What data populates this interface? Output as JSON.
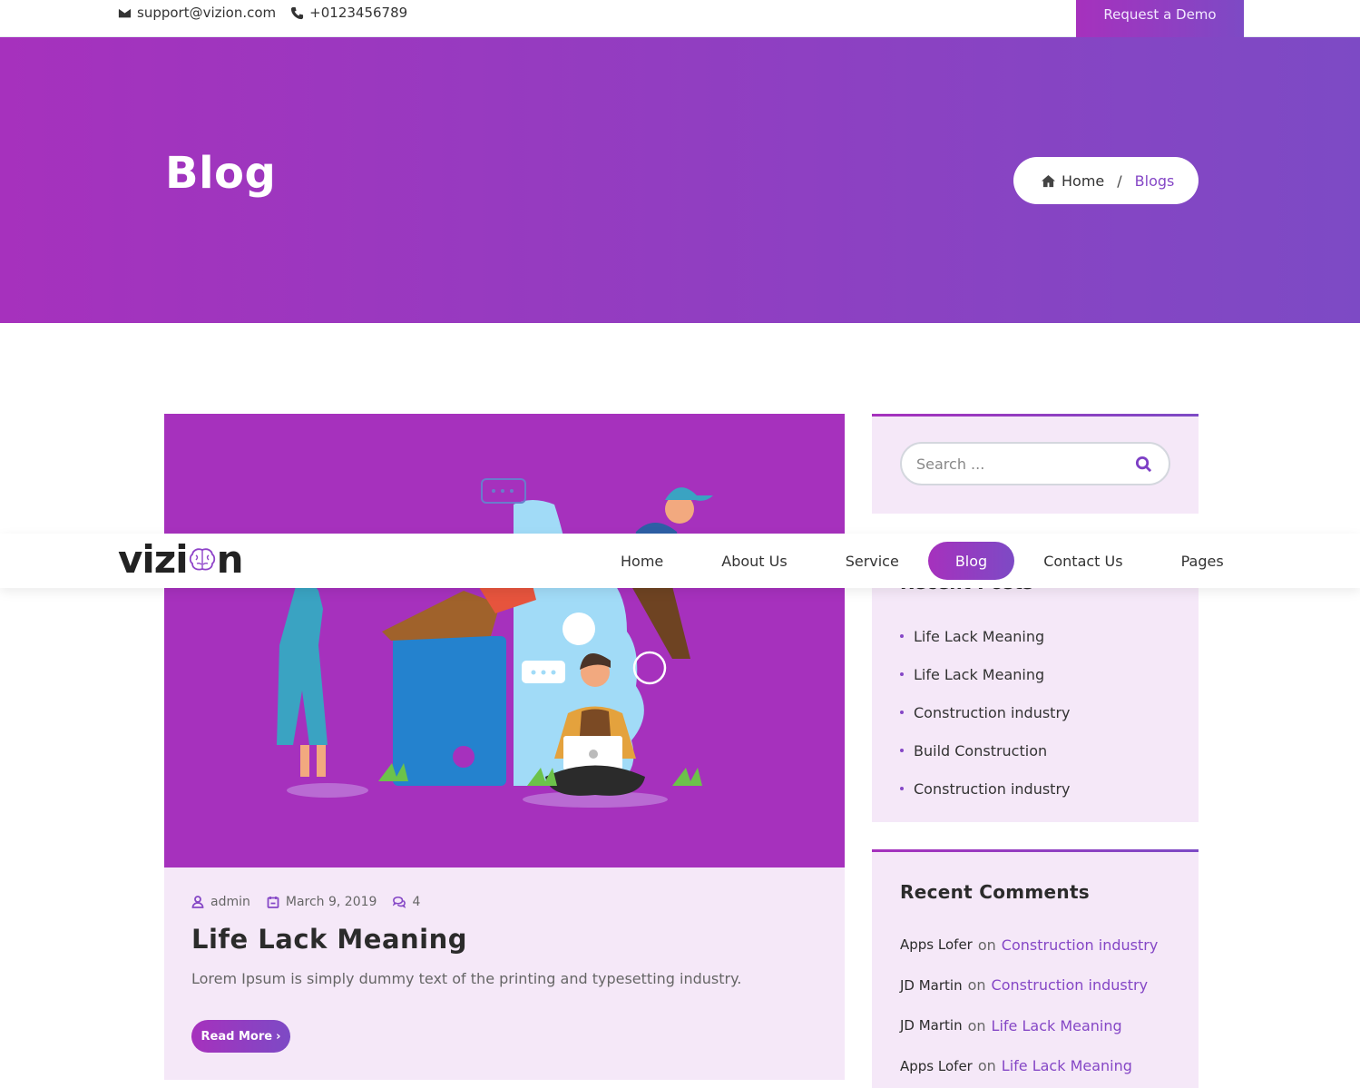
{
  "topbar": {
    "email": "support@vizion.com",
    "phone": "+0123456789",
    "demo_button": "Request a Demo"
  },
  "hero": {
    "title": "Blog",
    "breadcrumb": {
      "home": "Home",
      "separator": "/",
      "current": "Blogs"
    }
  },
  "navbar": {
    "logo_prefix": "vizi",
    "logo_suffix": "n",
    "items": [
      {
        "label": "Home",
        "active": false
      },
      {
        "label": "About Us",
        "active": false
      },
      {
        "label": "Service",
        "active": false
      },
      {
        "label": "Blog",
        "active": true
      },
      {
        "label": "Contact Us",
        "active": false
      },
      {
        "label": "Pages",
        "active": false
      }
    ]
  },
  "post": {
    "author": "admin",
    "date": "March 9, 2019",
    "comments": "4",
    "title": "Life Lack Meaning",
    "excerpt": "Lorem Ipsum is simply dummy text of the printing and typesetting industry.",
    "read_more": "Read More"
  },
  "sidebar": {
    "search_placeholder": "Search ...",
    "recent_posts_title": "Recent Posts",
    "recent_posts": [
      "Life Lack Meaning",
      "Life Lack Meaning",
      "Construction industry",
      "Build Construction",
      "Construction industry"
    ],
    "recent_comments_title": "Recent Comments",
    "recent_comments": [
      {
        "author": "Apps Lofer",
        "on": "on",
        "post": "Construction industry"
      },
      {
        "author": "JD Martin",
        "on": "on",
        "post": "Construction industry"
      },
      {
        "author": "JD Martin",
        "on": "on",
        "post": "Life Lack Meaning"
      },
      {
        "author": "Apps Lofer",
        "on": "on",
        "post": "Life Lack Meaning"
      }
    ]
  },
  "colors": {
    "gradient_start": "#a631bd",
    "gradient_end": "#7d4ac5",
    "accent": "#8547c6",
    "widget_bg": "#f5e8f8"
  }
}
